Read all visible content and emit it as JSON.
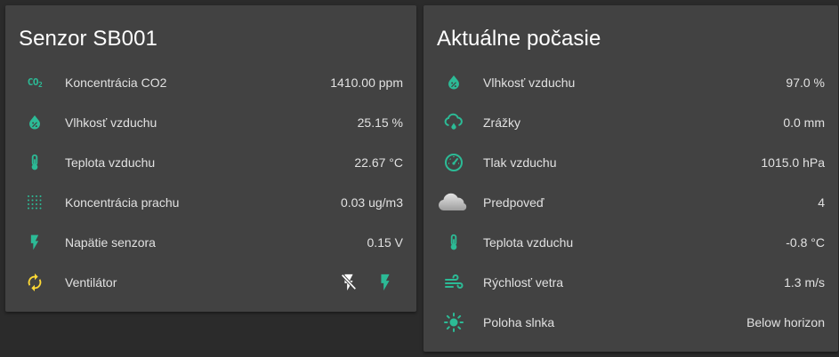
{
  "colors": {
    "accent": "#2cbb96",
    "fan_yellow": "#fdd835",
    "card_bg": "#424242",
    "page_bg": "#2b2b2b"
  },
  "sensor_card": {
    "title": "Senzor SB001",
    "rows": [
      {
        "icon": "co2-icon",
        "label": "Koncentrácia CO2",
        "value": "1410.00 ppm"
      },
      {
        "icon": "water-percent-icon",
        "label": "Vlhkosť vzduchu",
        "value": "25.15 %"
      },
      {
        "icon": "thermometer-icon",
        "label": "Teplota vzduchu",
        "value": "22.67 °C"
      },
      {
        "icon": "dots-grid-icon",
        "label": "Koncentrácia prachu",
        "value": "0.03 ug/m3"
      },
      {
        "icon": "flash-icon",
        "label": "Napätie senzora",
        "value": "0.15 V"
      },
      {
        "icon": "fan-cycle-icon",
        "label": "Ventilátor"
      }
    ],
    "fan_controls": {
      "off_icon": "flash-off-icon",
      "on_icon": "flash-icon"
    }
  },
  "weather_card": {
    "title": "Aktuálne počasie",
    "rows": [
      {
        "icon": "water-percent-icon",
        "label": "Vlhkosť vzduchu",
        "value": "97.0 %"
      },
      {
        "icon": "rain-cloud-icon",
        "label": "Zrážky",
        "value": "0.0 mm"
      },
      {
        "icon": "gauge-icon",
        "label": "Tlak vzduchu",
        "value": "1015.0 hPa"
      },
      {
        "icon": "cloudy-icon",
        "label": "Predpoveď",
        "value": "4"
      },
      {
        "icon": "thermometer-icon",
        "label": "Teplota vzduchu",
        "value": "-0.8 °C"
      },
      {
        "icon": "wind-icon",
        "label": "Rýchlosť vetra",
        "value": "1.3 m/s"
      },
      {
        "icon": "sun-icon",
        "label": "Poloha slnka",
        "value": "Below horizon"
      }
    ]
  }
}
